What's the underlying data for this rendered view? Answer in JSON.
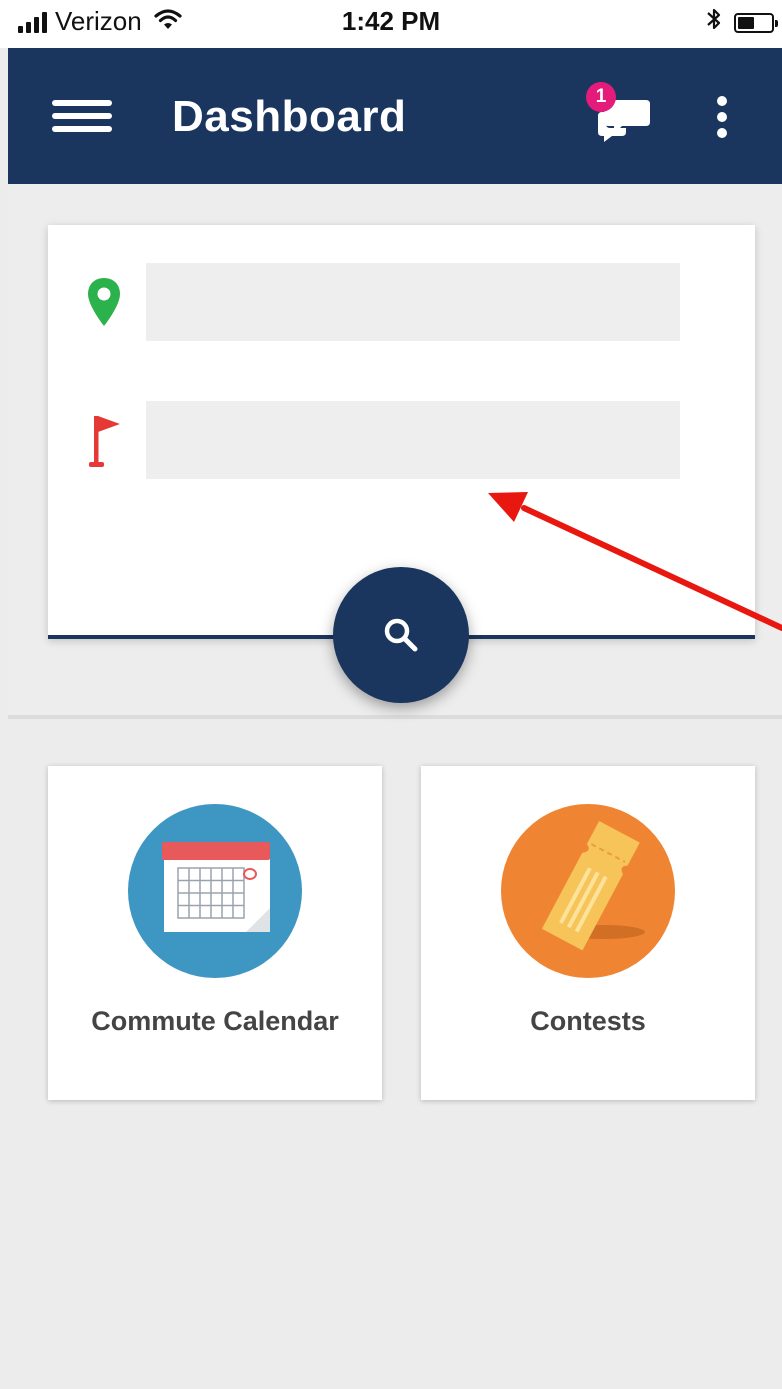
{
  "status_bar": {
    "carrier": "Verizon",
    "time": "1:42 PM"
  },
  "app_bar": {
    "title": "Dashboard",
    "message_count": "1",
    "color": "#1a355e"
  },
  "search": {
    "origin_value": "",
    "destination_value": "",
    "origin_icon": "map-pin-icon",
    "destination_icon": "flag-icon",
    "origin_color": "#2bb24c",
    "destination_color": "#e53935"
  },
  "tiles": [
    {
      "label": "Commute Calendar",
      "icon": "calendar-icon",
      "color": "#3d97c2"
    },
    {
      "label": "Contests",
      "icon": "ticket-icon",
      "color": "#ef8533"
    }
  ],
  "annotation": {
    "icon": "red-arrow",
    "color": "#e8170f"
  }
}
